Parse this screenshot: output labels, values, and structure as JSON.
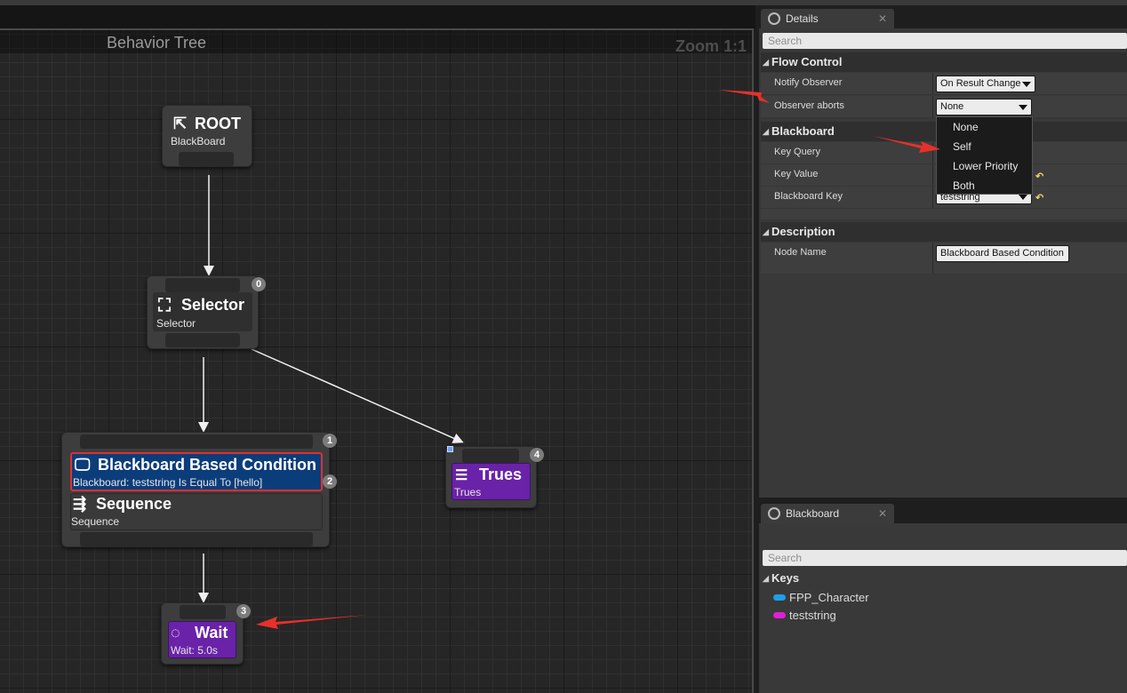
{
  "graph": {
    "title": "Behavior Tree",
    "zoom": "Zoom 1:1",
    "nodes": {
      "root": {
        "title": "ROOT",
        "subtitle": "BlackBoard"
      },
      "selector": {
        "title": "Selector",
        "subtitle": "Selector",
        "index": "0"
      },
      "condition": {
        "title": "Blackboard Based Condition",
        "subtitle": "Blackboard: teststring Is Equal To [hello]",
        "index": "1",
        "decorator_index": "2"
      },
      "sequence": {
        "title": "Sequence",
        "subtitle": "Sequence"
      },
      "trues": {
        "title": "Trues",
        "subtitle": "Trues",
        "index": "4"
      },
      "wait": {
        "title": "Wait",
        "subtitle": "Wait: 5.0s",
        "index": "3"
      }
    }
  },
  "details": {
    "tab_label": "Details",
    "search_placeholder": "Search",
    "sections": {
      "flow_control": "Flow Control",
      "blackboard": "Blackboard",
      "description": "Description"
    },
    "properties": {
      "notify_observer": {
        "label": "Notify Observer",
        "value": "On Result Change"
      },
      "observer_aborts": {
        "label": "Observer aborts",
        "value": "None"
      },
      "key_query": {
        "label": "Key Query"
      },
      "key_value": {
        "label": "Key Value"
      },
      "blackboard_key": {
        "label": "Blackboard Key",
        "value": "teststring"
      },
      "node_name": {
        "label": "Node Name",
        "value": "Blackboard Based Condition"
      }
    },
    "observer_aborts_options": [
      "None",
      "Self",
      "Lower Priority",
      "Both"
    ]
  },
  "blackboard_panel": {
    "tab_label": "Blackboard",
    "search_placeholder": "Search",
    "keys_header": "Keys",
    "keys": [
      {
        "name": "FPP_Character",
        "color": "#1e9ee8"
      },
      {
        "name": "teststring",
        "color": "#e020d8"
      }
    ]
  },
  "colors": {
    "condition_blue": "#0b3d7a",
    "task_purple": "#6a22a8",
    "selection_red": "#e03030",
    "annotation_red": "#e8302a"
  }
}
